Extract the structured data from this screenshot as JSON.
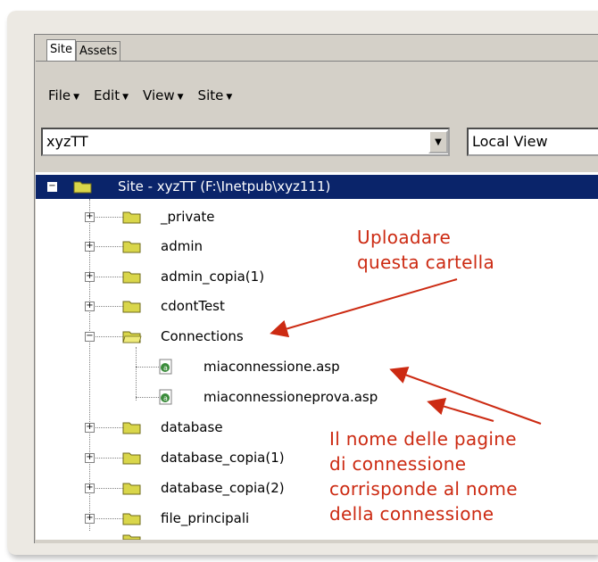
{
  "tabs": [
    {
      "label": "Site"
    },
    {
      "label": "Assets"
    }
  ],
  "menu": [
    {
      "label": "File"
    },
    {
      "label": "Edit"
    },
    {
      "label": "View"
    },
    {
      "label": "Site"
    }
  ],
  "site_select": {
    "value": "xyzTT"
  },
  "view_select": {
    "value": "Local View"
  },
  "tree": {
    "root": "Site - xyzTT (F:\\Inetpub\\xyz111)",
    "items": [
      {
        "label": "_private",
        "type": "folder",
        "expanded": false
      },
      {
        "label": "admin",
        "type": "folder",
        "expanded": false
      },
      {
        "label": "admin_copia(1)",
        "type": "folder",
        "expanded": false
      },
      {
        "label": "cdontTest",
        "type": "folder",
        "expanded": false
      },
      {
        "label": "Connections",
        "type": "folder",
        "expanded": true
      },
      {
        "label": "miaconnessione.asp",
        "type": "file"
      },
      {
        "label": "miaconnessioneprova.asp",
        "type": "file"
      },
      {
        "label": "database",
        "type": "folder",
        "expanded": false
      },
      {
        "label": "database_copia(1)",
        "type": "folder",
        "expanded": false
      },
      {
        "label": "database_copia(2)",
        "type": "folder",
        "expanded": false
      },
      {
        "label": "file_principali",
        "type": "folder",
        "expanded": false
      }
    ]
  },
  "annotations": {
    "upload_note": "Uploadare\nquesta cartella",
    "pages_note": "Il nome delle pagine\ndi connessione\ncorrisponde al nome\ndella connessione"
  },
  "colors": {
    "annotation": "#cc2a12",
    "selection": "#0a246a",
    "folder": "#d9d64a"
  }
}
